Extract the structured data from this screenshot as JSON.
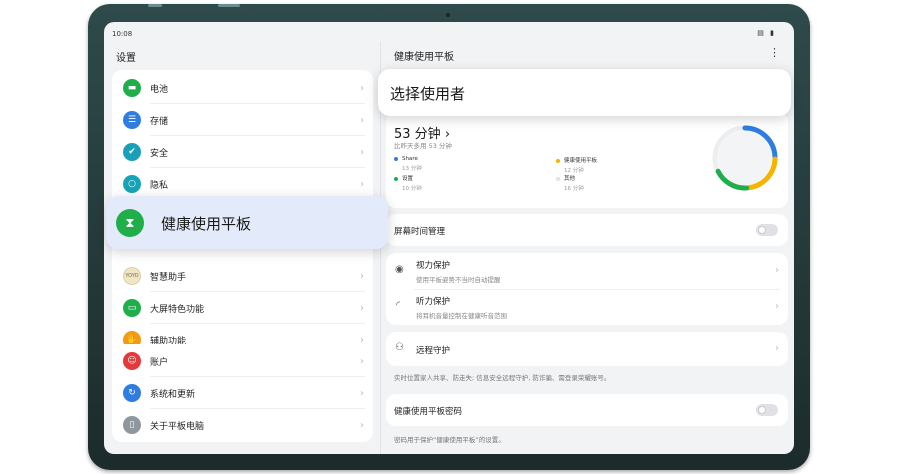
{
  "status_bar": {
    "time": "10:08",
    "indicators": "▤ ▮"
  },
  "left_panel": {
    "title": "设置",
    "group1": [
      {
        "label": "电池",
        "icon": "battery-icon",
        "color": "#1fae4a",
        "glyph": "▬"
      },
      {
        "label": "存储",
        "icon": "storage-icon",
        "color": "#2f7de1",
        "glyph": "☰"
      },
      {
        "label": "安全",
        "icon": "shield-icon",
        "color": "#19a0b8",
        "glyph": "✔"
      },
      {
        "label": "隐私",
        "icon": "lock-icon",
        "color": "#16a3b7",
        "glyph": "○"
      }
    ],
    "group1b": [
      {
        "label": "智慧助手",
        "icon": "yoyo-icon",
        "color": "#e8d9a8",
        "glyph": "YOYO"
      },
      {
        "label": "大屏特色功能",
        "icon": "screen-feature-icon",
        "color": "#1fae4a",
        "glyph": "▭"
      },
      {
        "label": "辅助功能",
        "icon": "hand-icon",
        "color": "#f39a12",
        "glyph": "✋"
      }
    ],
    "group2": [
      {
        "label": "账户",
        "icon": "account-icon",
        "color": "#e5383b",
        "glyph": "☺"
      },
      {
        "label": "系统和更新",
        "icon": "system-update-icon",
        "color": "#2f7de1",
        "glyph": "↻"
      },
      {
        "label": "关于平板电脑",
        "icon": "tablet-icon",
        "color": "#8f969c",
        "glyph": "▯"
      }
    ]
  },
  "popup_left": {
    "label": "健康使用平板",
    "icon": "hourglass-icon"
  },
  "right_panel": {
    "title": "健康使用平板",
    "more": "⋮",
    "popup": {
      "label": "选择使用者"
    },
    "usage": {
      "total": "53 分钟",
      "compare": "比昨天多用 53 分钟",
      "legend": [
        {
          "name": "Share",
          "value": "13 分钟",
          "color": "#2f7de1"
        },
        {
          "name": "健康使用平板",
          "value": "12 分钟",
          "color": "#f5b400"
        },
        {
          "name": "设置",
          "value": "10 分钟",
          "color": "#1fae4a"
        },
        {
          "name": "其他",
          "value": "16 分钟",
          "color": "#eceef0"
        }
      ]
    },
    "screen_time": {
      "label": "屏幕时间管理",
      "enabled": false
    },
    "eye": {
      "title": "视力保护",
      "sub": "使用平板姿势不当时自动提醒"
    },
    "ear": {
      "title": "听力保护",
      "sub": "将耳机音量控制在健康听音范围"
    },
    "remote": {
      "title": "远程守护",
      "note": "实时位置家人共享、防走失; 信息安全远程守护, 防诈骗、需登录荣耀账号。"
    },
    "password": {
      "title": "健康使用平板密码",
      "enabled": false,
      "note": "密码用于保护“健康使用平板”的设置。"
    }
  }
}
